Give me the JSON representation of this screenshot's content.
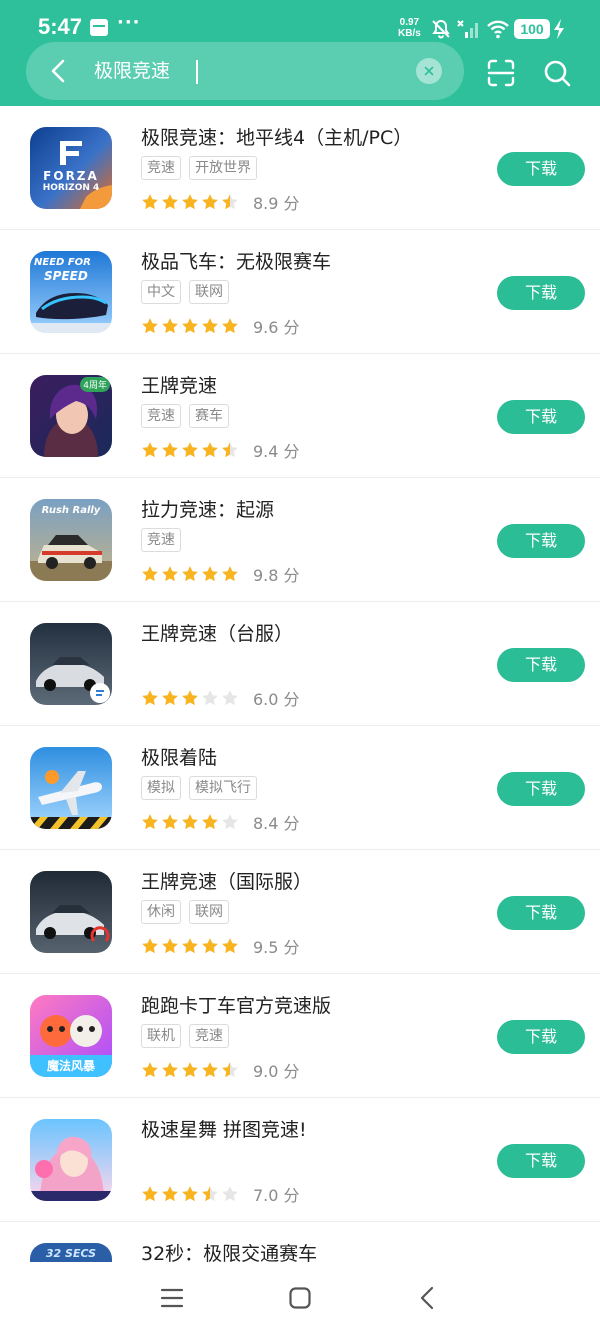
{
  "status_bar": {
    "time": "5:47",
    "more": "···",
    "net_speed_value": "0.97",
    "net_speed_unit": "KB/s",
    "battery": "100"
  },
  "search": {
    "query": "极限竞速",
    "clear_symbol": "×"
  },
  "colors": {
    "primary": "#2ec09b",
    "button": "#2bbd95",
    "star": "#f8b521",
    "star_empty": "#e6e6e6"
  },
  "apps": [
    {
      "name": "极限竞速：地平线4（主机/PC）",
      "tags": [
        "竞速",
        "开放世界"
      ],
      "rating": 4.5,
      "score": "8.9 分",
      "button": "下载",
      "icon": "forza-horizon-icon"
    },
    {
      "name": "极品飞车：无极限赛车",
      "tags": [
        "中文",
        "联网"
      ],
      "rating": 5,
      "score": "9.6 分",
      "button": "下载",
      "icon": "need-for-speed-icon"
    },
    {
      "name": "王牌竞速",
      "tags": [
        "竞速",
        "赛车"
      ],
      "rating": 4.5,
      "score": "9.4 分",
      "button": "下载",
      "icon": "ace-racer-icon"
    },
    {
      "name": "拉力竞速：起源",
      "tags": [
        "竞速"
      ],
      "rating": 5,
      "score": "9.8 分",
      "button": "下载",
      "icon": "rush-rally-icon"
    },
    {
      "name": "王牌竞速（台服）",
      "tags": [],
      "rating": 3,
      "score": "6.0 分",
      "button": "下载",
      "icon": "ace-racer-tw-icon"
    },
    {
      "name": "极限着陆",
      "tags": [
        "模拟",
        "模拟飞行"
      ],
      "rating": 4,
      "score": "8.4 分",
      "button": "下载",
      "icon": "airplane-icon"
    },
    {
      "name": "王牌竞速（国际服）",
      "tags": [
        "休闲",
        "联网"
      ],
      "rating": 5,
      "score": "9.5 分",
      "button": "下载",
      "icon": "ace-racer-global-icon"
    },
    {
      "name": "跑跑卡丁车官方竞速版",
      "tags": [
        "联机",
        "竞速"
      ],
      "rating": 4.5,
      "score": "9.0 分",
      "button": "下载",
      "icon": "kartrider-icon"
    },
    {
      "name": "极速星舞 拼图竞速!",
      "tags": [],
      "rating": 3.5,
      "score": "7.0 分",
      "button": "下载",
      "icon": "anime-girl-icon"
    },
    {
      "name": "32秒：极限交通赛车",
      "tags": [],
      "rating": 0,
      "score": "",
      "button": "",
      "icon": "32-secs-icon"
    }
  ],
  "icon_labels": {
    "forza_top": "FORZA",
    "forza_bottom": "HORIZON 4",
    "nfs_top": "NEED FOR",
    "nfs_bottom": "SPEED",
    "rush_rally": "Rush Rally",
    "ace_badge": "4周年",
    "kart_banner": "魔法风暴",
    "secs": "32 SECS"
  }
}
